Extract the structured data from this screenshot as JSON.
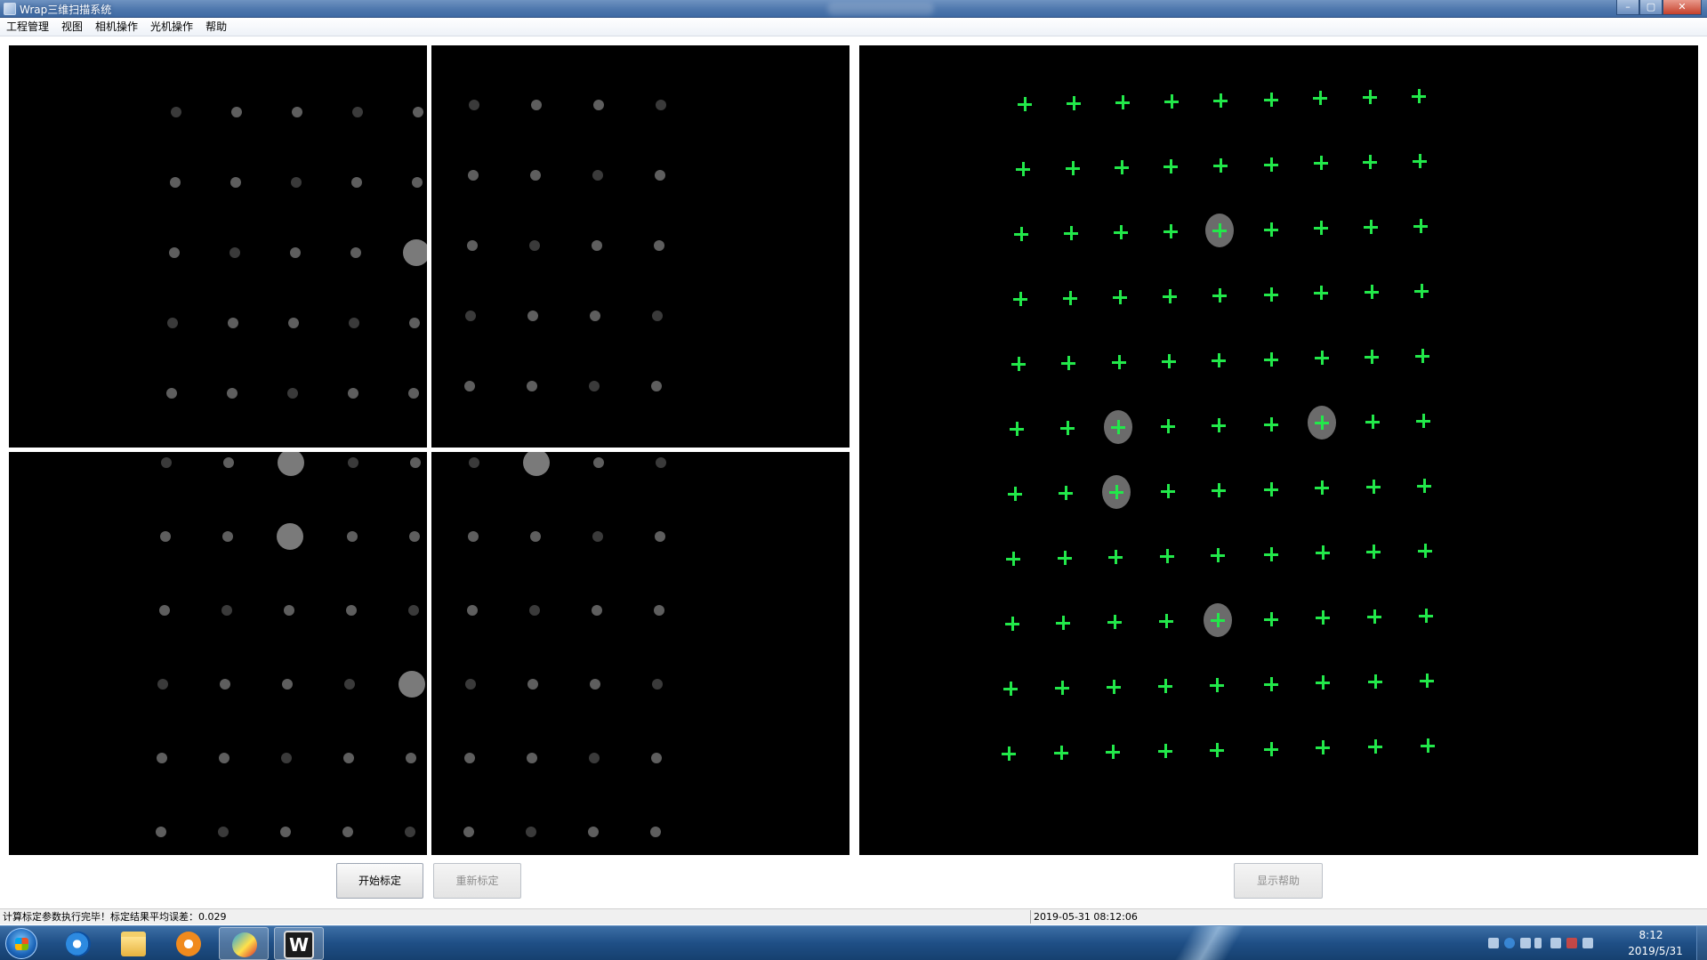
{
  "window": {
    "title": "Wrap三维扫描系统",
    "controls": [
      "minimize",
      "maximize",
      "close"
    ]
  },
  "menu": [
    "工程管理",
    "视图",
    "相机操作",
    "光机操作",
    "帮助"
  ],
  "buttons": {
    "start_calibration": "开始标定",
    "recalibrate": "重新标定",
    "show_help": "显示帮助"
  },
  "status": {
    "message": "计算标定参数执行完毕！标定结果平均误差：0.029",
    "timestamp": "2019-05-31 08:12:06"
  },
  "taskbar": {
    "apps": [
      "start-orb",
      "internet-explorer-icon",
      "file-explorer-icon",
      "media-player-icon",
      "app-icon",
      "wrap-app-icon"
    ],
    "wrap_app_label": "W",
    "clock_time": "8:12",
    "clock_date": "2019/5/31"
  },
  "colors": {
    "marker": "#22e84a",
    "view_background": "#000000",
    "titlebar": "#4e77ad",
    "taskbar": "#1f4f86"
  }
}
